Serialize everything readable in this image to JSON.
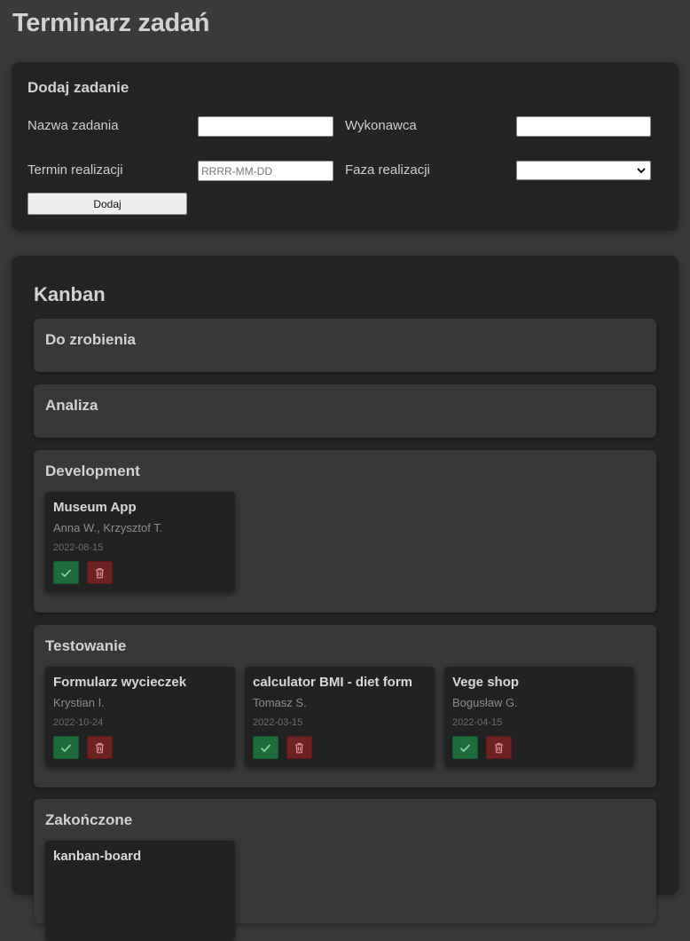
{
  "app": {
    "title": "Terminarz zadań"
  },
  "form": {
    "title": "Dodaj zadanie",
    "task_name_label": "Nazwa zadania",
    "task_name_value": "",
    "assignee_label": "Wykonawca",
    "assignee_value": "",
    "deadline_label": "Termin realizacji",
    "deadline_placeholder": "RRRR-MM-DD",
    "deadline_value": "",
    "phase_label": "Faza realizacji",
    "phase_selected": "",
    "add_button_label": "Dodaj"
  },
  "kanban": {
    "title": "Kanban",
    "columns": [
      {
        "title": "Do zrobienia",
        "cards": []
      },
      {
        "title": "Analiza",
        "cards": []
      },
      {
        "title": "Development",
        "cards": [
          {
            "title": "Museum App",
            "assignee": "Anna W., Krzysztof T.",
            "date": "2022-08-15"
          }
        ]
      },
      {
        "title": "Testowanie",
        "cards": [
          {
            "title": "Formularz wycieczek",
            "assignee": "Krystian I.",
            "date": "2022-10-24"
          },
          {
            "title": "calculator BMI - diet form",
            "assignee": "Tomasz S.",
            "date": "2022-03-15"
          },
          {
            "title": "Vege shop",
            "assignee": "Bogusław G.",
            "date": "2022-04-15"
          }
        ]
      },
      {
        "title": "Zakończone",
        "cards": [
          {
            "title": "kanban-board",
            "assignee": "",
            "date": ""
          }
        ]
      }
    ]
  },
  "icons": {
    "done": "check-icon",
    "delete": "trash-icon",
    "select": "chevron-down-icon"
  },
  "colors": {
    "page_background": "#3a3a3a",
    "panel_background": "#242424",
    "column_background": "#383838",
    "card_background": "#222222",
    "done_button": "#1f6b3c",
    "delete_button": "#6e2222"
  }
}
